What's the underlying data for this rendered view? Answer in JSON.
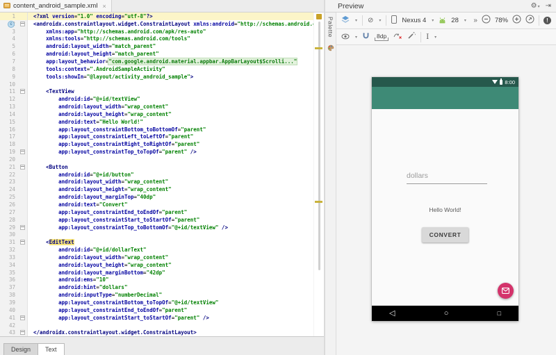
{
  "editor": {
    "tab": {
      "title": "content_android_sample.xml"
    },
    "bottom_tabs": [
      {
        "label": "Design",
        "active": false
      },
      {
        "label": "Text",
        "active": true
      }
    ],
    "lines": [
      {
        "n": 1,
        "caret": true,
        "tk": [
          [
            "T",
            "<?xml "
          ],
          [
            "A",
            "version"
          ],
          [
            "P",
            "="
          ],
          [
            "V",
            "\"1.0\""
          ],
          [
            "P",
            " "
          ],
          [
            "A",
            "encoding"
          ],
          [
            "P",
            "="
          ],
          [
            "V",
            "\"utf-8\""
          ],
          [
            "T",
            "?>"
          ]
        ]
      },
      {
        "n": 2,
        "badge": "c",
        "fold": "start",
        "tk": [
          [
            "T",
            "<androidx.constraintlayout.widget.ConstraintLayout"
          ],
          [
            "P",
            " "
          ],
          [
            "A",
            "xmlns:android"
          ],
          [
            "P",
            "="
          ],
          [
            "V",
            "\"http://schemas.android.com/apk/res/android\""
          ]
        ]
      },
      {
        "n": 3,
        "tk": [
          [
            "P",
            "    "
          ],
          [
            "A",
            "xmlns:app"
          ],
          [
            "P",
            "="
          ],
          [
            "V",
            "\"http://schemas.android.com/apk/res-auto\""
          ]
        ]
      },
      {
        "n": 4,
        "tk": [
          [
            "P",
            "    "
          ],
          [
            "A",
            "xmlns:tools"
          ],
          [
            "P",
            "="
          ],
          [
            "V",
            "\"http://schemas.android.com/tools\""
          ]
        ]
      },
      {
        "n": 5,
        "tk": [
          [
            "P",
            "    "
          ],
          [
            "A",
            "android:layout_width"
          ],
          [
            "P",
            "="
          ],
          [
            "V",
            "\"match_parent\""
          ]
        ]
      },
      {
        "n": 6,
        "tk": [
          [
            "P",
            "    "
          ],
          [
            "A",
            "android:layout_height"
          ],
          [
            "P",
            "="
          ],
          [
            "V",
            "\"match_parent\""
          ]
        ]
      },
      {
        "n": 7,
        "tk": [
          [
            "P",
            "    "
          ],
          [
            "A",
            "app:layout_behavior"
          ],
          [
            "P",
            "="
          ],
          [
            "F",
            "\"com.google.android.material.appbar.AppBarLayout$Scrolli...\""
          ]
        ]
      },
      {
        "n": 8,
        "tk": [
          [
            "P",
            "    "
          ],
          [
            "A",
            "tools:context"
          ],
          [
            "P",
            "="
          ],
          [
            "V",
            "\".AndroidSampleActivity\""
          ]
        ]
      },
      {
        "n": 9,
        "tk": [
          [
            "P",
            "    "
          ],
          [
            "A",
            "tools:showIn"
          ],
          [
            "P",
            "="
          ],
          [
            "V",
            "\"@layout/activity_android_sample\""
          ],
          [
            "T",
            ">"
          ]
        ]
      },
      {
        "n": 10,
        "tk": []
      },
      {
        "n": 11,
        "fold": "start",
        "tk": [
          [
            "P",
            "    "
          ],
          [
            "T",
            "<TextView"
          ]
        ]
      },
      {
        "n": 12,
        "tk": [
          [
            "P",
            "        "
          ],
          [
            "A",
            "android:id"
          ],
          [
            "P",
            "="
          ],
          [
            "V",
            "\"@+id/textView\""
          ]
        ]
      },
      {
        "n": 13,
        "tk": [
          [
            "P",
            "        "
          ],
          [
            "A",
            "android:layout_width"
          ],
          [
            "P",
            "="
          ],
          [
            "V",
            "\"wrap_content\""
          ]
        ]
      },
      {
        "n": 14,
        "tk": [
          [
            "P",
            "        "
          ],
          [
            "A",
            "android:layout_height"
          ],
          [
            "P",
            "="
          ],
          [
            "V",
            "\"wrap_content\""
          ]
        ]
      },
      {
        "n": 15,
        "tk": [
          [
            "P",
            "        "
          ],
          [
            "A",
            "android:text"
          ],
          [
            "P",
            "="
          ],
          [
            "V",
            "\"Hello World!\""
          ]
        ]
      },
      {
        "n": 16,
        "tk": [
          [
            "P",
            "        "
          ],
          [
            "A",
            "app:layout_constraintBottom_toBottomOf"
          ],
          [
            "P",
            "="
          ],
          [
            "V",
            "\"parent\""
          ]
        ]
      },
      {
        "n": 17,
        "tk": [
          [
            "P",
            "        "
          ],
          [
            "A",
            "app:layout_constraintLeft_toLeftOf"
          ],
          [
            "P",
            "="
          ],
          [
            "V",
            "\"parent\""
          ]
        ]
      },
      {
        "n": 18,
        "tk": [
          [
            "P",
            "        "
          ],
          [
            "A",
            "app:layout_constraintRight_toRightOf"
          ],
          [
            "P",
            "="
          ],
          [
            "V",
            "\"parent\""
          ]
        ]
      },
      {
        "n": 19,
        "fold": "end",
        "tk": [
          [
            "P",
            "        "
          ],
          [
            "A",
            "app:layout_constraintTop_toTopOf"
          ],
          [
            "P",
            "="
          ],
          [
            "V",
            "\"parent\""
          ],
          [
            "T",
            " />"
          ]
        ]
      },
      {
        "n": 20,
        "tk": []
      },
      {
        "n": 21,
        "fold": "start",
        "tk": [
          [
            "P",
            "    "
          ],
          [
            "T",
            "<Button"
          ]
        ]
      },
      {
        "n": 22,
        "tk": [
          [
            "P",
            "        "
          ],
          [
            "A",
            "android:id"
          ],
          [
            "P",
            "="
          ],
          [
            "V",
            "\"@+id/button\""
          ]
        ]
      },
      {
        "n": 23,
        "tk": [
          [
            "P",
            "        "
          ],
          [
            "A",
            "android:layout_width"
          ],
          [
            "P",
            "="
          ],
          [
            "V",
            "\"wrap_content\""
          ]
        ]
      },
      {
        "n": 24,
        "tk": [
          [
            "P",
            "        "
          ],
          [
            "A",
            "android:layout_height"
          ],
          [
            "P",
            "="
          ],
          [
            "V",
            "\"wrap_content\""
          ]
        ]
      },
      {
        "n": 25,
        "tk": [
          [
            "P",
            "        "
          ],
          [
            "A",
            "android:layout_marginTop"
          ],
          [
            "P",
            "="
          ],
          [
            "V",
            "\"40dp\""
          ]
        ]
      },
      {
        "n": 26,
        "tk": [
          [
            "P",
            "        "
          ],
          [
            "A",
            "android:text"
          ],
          [
            "P",
            "="
          ],
          [
            "V",
            "\"Convert\""
          ]
        ]
      },
      {
        "n": 27,
        "tk": [
          [
            "P",
            "        "
          ],
          [
            "A",
            "app:layout_constraintEnd_toEndOf"
          ],
          [
            "P",
            "="
          ],
          [
            "V",
            "\"parent\""
          ]
        ]
      },
      {
        "n": 28,
        "tk": [
          [
            "P",
            "        "
          ],
          [
            "A",
            "app:layout_constraintStart_toStartOf"
          ],
          [
            "P",
            "="
          ],
          [
            "V",
            "\"parent\""
          ]
        ]
      },
      {
        "n": 29,
        "fold": "end",
        "tk": [
          [
            "P",
            "        "
          ],
          [
            "A",
            "app:layout_constraintTop_toBottomOf"
          ],
          [
            "P",
            "="
          ],
          [
            "V",
            "\"@+id/textView\""
          ],
          [
            "T",
            " />"
          ]
        ]
      },
      {
        "n": 30,
        "tk": []
      },
      {
        "n": 31,
        "fold": "start",
        "tk": [
          [
            "P",
            "    "
          ],
          [
            "T",
            "<"
          ],
          [
            "H",
            "EditText"
          ]
        ]
      },
      {
        "n": 32,
        "tk": [
          [
            "P",
            "        "
          ],
          [
            "A",
            "android:id"
          ],
          [
            "P",
            "="
          ],
          [
            "V",
            "\"@+id/dollarText\""
          ]
        ]
      },
      {
        "n": 33,
        "tk": [
          [
            "P",
            "        "
          ],
          [
            "A",
            "android:layout_width"
          ],
          [
            "P",
            "="
          ],
          [
            "V",
            "\"wrap_content\""
          ]
        ]
      },
      {
        "n": 34,
        "tk": [
          [
            "P",
            "        "
          ],
          [
            "A",
            "android:layout_height"
          ],
          [
            "P",
            "="
          ],
          [
            "V",
            "\"wrap_content\""
          ]
        ]
      },
      {
        "n": 35,
        "tk": [
          [
            "P",
            "        "
          ],
          [
            "A",
            "android:layout_marginBottom"
          ],
          [
            "P",
            "="
          ],
          [
            "V",
            "\"42dp\""
          ]
        ]
      },
      {
        "n": 36,
        "tk": [
          [
            "P",
            "        "
          ],
          [
            "A",
            "android:ems"
          ],
          [
            "P",
            "="
          ],
          [
            "V",
            "\"10\""
          ]
        ]
      },
      {
        "n": 37,
        "tk": [
          [
            "P",
            "        "
          ],
          [
            "A",
            "android:hint"
          ],
          [
            "P",
            "="
          ],
          [
            "V",
            "\"dollars\""
          ]
        ]
      },
      {
        "n": 38,
        "tk": [
          [
            "P",
            "        "
          ],
          [
            "A",
            "android:inputType"
          ],
          [
            "P",
            "="
          ],
          [
            "V",
            "\"numberDecimal\""
          ]
        ]
      },
      {
        "n": 39,
        "tk": [
          [
            "P",
            "        "
          ],
          [
            "A",
            "app:layout_constraintBottom_toTopOf"
          ],
          [
            "P",
            "="
          ],
          [
            "V",
            "\"@+id/textView\""
          ]
        ]
      },
      {
        "n": 40,
        "tk": [
          [
            "P",
            "        "
          ],
          [
            "A",
            "app:layout_constraintEnd_toEndOf"
          ],
          [
            "P",
            "="
          ],
          [
            "V",
            "\"parent\""
          ]
        ]
      },
      {
        "n": 41,
        "fold": "end",
        "tk": [
          [
            "P",
            "        "
          ],
          [
            "A",
            "app:layout_constraintStart_toStartOf"
          ],
          [
            "P",
            "="
          ],
          [
            "V",
            "\"parent\""
          ],
          [
            "T",
            " />"
          ]
        ]
      },
      {
        "n": 42,
        "tk": []
      },
      {
        "n": 43,
        "fold": "end",
        "tk": [
          [
            "T",
            "</androidx.constraintlayout.widget.ConstraintLayout>"
          ]
        ]
      }
    ]
  },
  "preview": {
    "title": "Preview",
    "palette_label": "Palette",
    "toolbar": {
      "device": "Nexus 4",
      "api": "28",
      "zoom_level": "78%",
      "default_margins": "8dp",
      "error_count": "!"
    }
  },
  "phone": {
    "time": "8:00",
    "hint": "dollars",
    "hello": "Hello World!",
    "button": "CONVERT"
  },
  "icons": {
    "close": "×",
    "gear": "⚙",
    "hide_panel": "⇥",
    "dropdown": "▾",
    "chevrons": "»",
    "orientation": "⊘",
    "ibeam": "Ⅰ",
    "nav_back": "◁",
    "nav_home": "○",
    "nav_recent": "□"
  },
  "colors": {
    "statusbar": "#26584C",
    "appbar": "#3E8A76",
    "fab_accent": "#D4336B",
    "xml_tag": "#000080",
    "xml_attr": "#0000A0",
    "xml_value": "#008000",
    "caret_line_bg": "#FCF5C8",
    "folded_value_bg": "#E3F2DD",
    "identifier_highlight_bg": "#F6E37A",
    "warning_stripe": "#C9B33C"
  }
}
